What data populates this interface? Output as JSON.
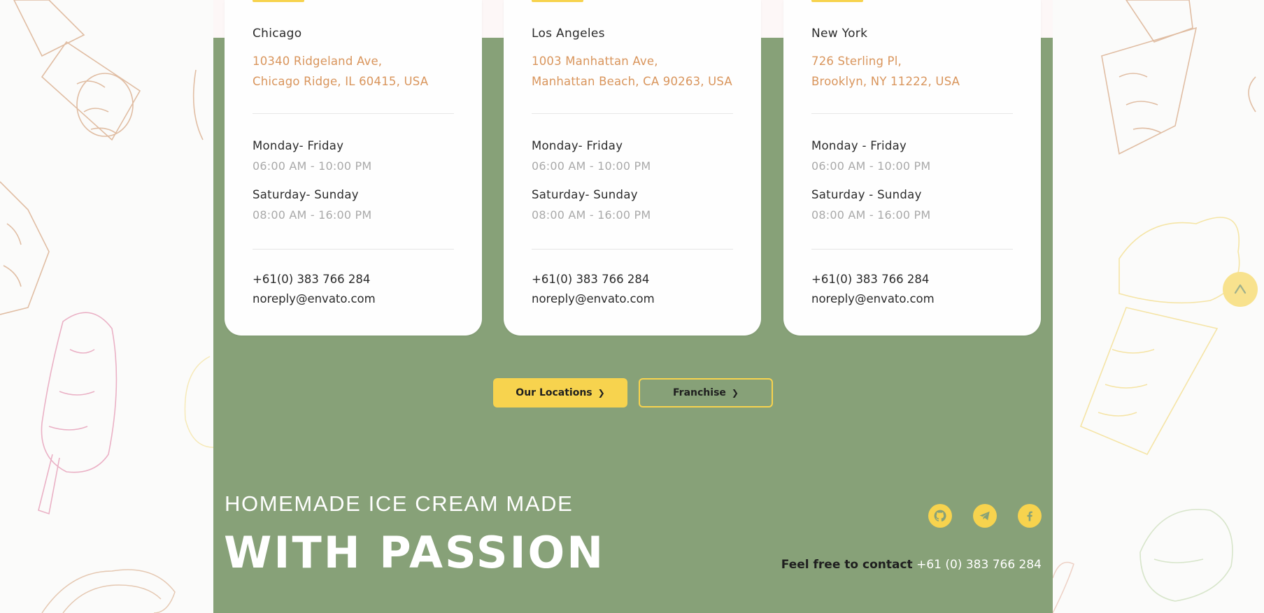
{
  "locations": [
    {
      "city": "Chicago",
      "address_line1": "10340 Ridgeland Ave,",
      "address_line2": "Chicago Ridge, IL 60415, USA",
      "weekday_label": "Monday- Friday",
      "weekday_hours": "06:00 AM - 10:00 PM",
      "weekend_label": "Saturday- Sunday",
      "weekend_hours": "08:00 AM - 16:00 PM",
      "phone": "+61(0) 383 766 284",
      "email": "noreply@envato.com"
    },
    {
      "city": "Los Angeles",
      "address_line1": "1003 Manhattan Ave,",
      "address_line2": "Manhattan Beach, CA 90263, USA",
      "weekday_label": "Monday- Friday",
      "weekday_hours": "06:00 AM - 10:00 PM",
      "weekend_label": "Saturday- Sunday",
      "weekend_hours": "08:00 AM - 16:00 PM",
      "phone": "+61(0) 383 766 284",
      "email": "noreply@envato.com"
    },
    {
      "city": "New York",
      "address_line1": "726 Sterling Pl,",
      "address_line2": "Brooklyn, NY 11222, USA",
      "weekday_label": "Monday - Friday",
      "weekday_hours": "06:00 AM - 10:00 PM",
      "weekend_label": "Saturday - Sunday",
      "weekend_hours": "08:00 AM - 16:00 PM",
      "phone": "+61(0) 383 766 284",
      "email": "noreply@envato.com"
    }
  ],
  "buttons": {
    "locations_label": "Our Locations",
    "franchise_label": "Franchise"
  },
  "footer": {
    "tagline_top": "HOMEMADE ICE CREAM MADE",
    "tagline_bottom": "WITH PASSION",
    "contact_label": "Feel free to contact",
    "contact_number": "+61 (0) 383 766 284",
    "social_icons": [
      "github-icon",
      "telegram-icon",
      "facebook-icon"
    ]
  },
  "scroll_top_icon": "caret-up-icon",
  "colors": {
    "section_green": "#87a178",
    "accent_yellow": "#f7d34e",
    "address_orange": "#d9955c",
    "muted_gray": "#a9a9a9"
  }
}
